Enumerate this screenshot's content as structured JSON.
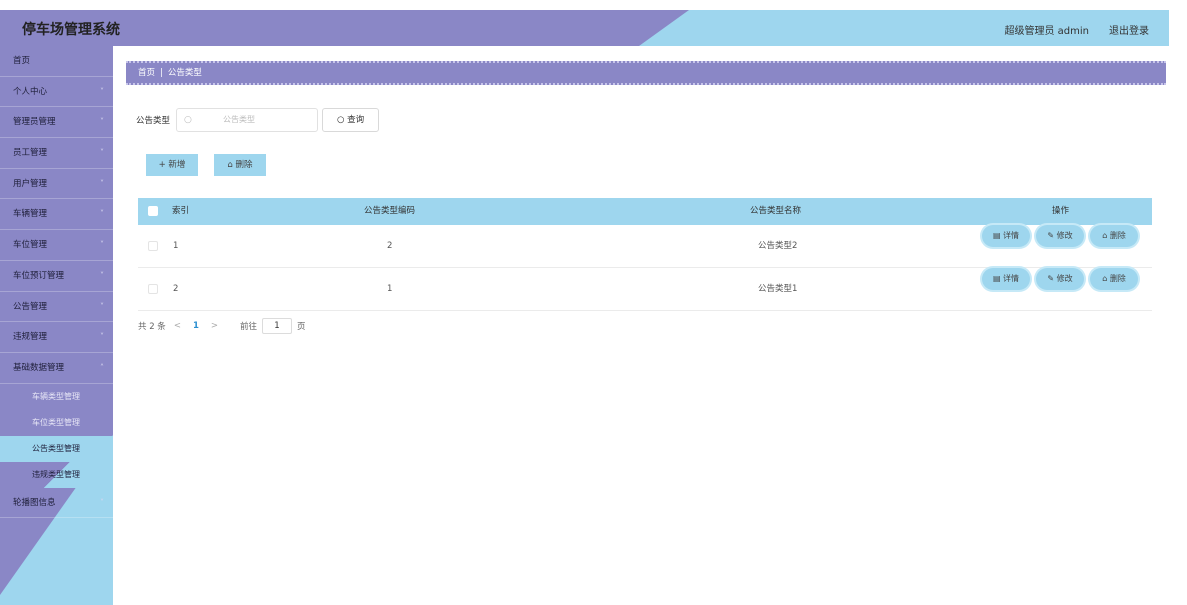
{
  "header": {
    "brand": "停车场管理系统",
    "user": "超级管理员 admin",
    "logout": "退出登录"
  },
  "sidebar": {
    "items": [
      {
        "label": "首页",
        "chevron": ""
      },
      {
        "label": "个人中心",
        "chevron": "˅"
      },
      {
        "label": "管理员管理",
        "chevron": "˅"
      },
      {
        "label": "员工管理",
        "chevron": "˅"
      },
      {
        "label": "用户管理",
        "chevron": "˅"
      },
      {
        "label": "车辆管理",
        "chevron": "˅"
      },
      {
        "label": "车位管理",
        "chevron": "˅"
      },
      {
        "label": "车位预订管理",
        "chevron": "˅"
      },
      {
        "label": "公告管理",
        "chevron": "˅"
      },
      {
        "label": "违规管理",
        "chevron": "˅"
      },
      {
        "label": "基础数据管理",
        "chevron": "˄"
      }
    ],
    "sub_items": [
      {
        "label": "车辆类型管理"
      },
      {
        "label": "车位类型管理"
      },
      {
        "label": "公告类型管理"
      },
      {
        "label": "违规类型管理"
      }
    ],
    "last_item": {
      "label": "轮播图信息",
      "chevron": "˅"
    }
  },
  "breadcrumb": {
    "home": "首页",
    "sep": "|",
    "current": "公告类型"
  },
  "search": {
    "label": "公告类型",
    "placeholder": "公告类型",
    "search_icon": "search-icon",
    "query_button": "查询"
  },
  "actions": {
    "add": "+ 新增",
    "delete": "删除"
  },
  "table": {
    "headers": {
      "index": "索引",
      "code": "公告类型编码",
      "name": "公告类型名称",
      "ops": "操作"
    },
    "rows": [
      {
        "index": "1",
        "code": "2",
        "name": "公告类型2"
      },
      {
        "index": "2",
        "code": "1",
        "name": "公告类型1"
      }
    ],
    "op_labels": {
      "detail": "详情",
      "edit": "修改",
      "delete": "删除"
    }
  },
  "pager": {
    "total": "共 2 条",
    "prev": "<",
    "current": "1",
    "next": ">",
    "goto": "前往",
    "page_value": "1",
    "page_suffix": "页"
  },
  "colors": {
    "purple": "#8a87c6",
    "cyan": "#9ed6ee",
    "accent": "#2a8fd0"
  }
}
